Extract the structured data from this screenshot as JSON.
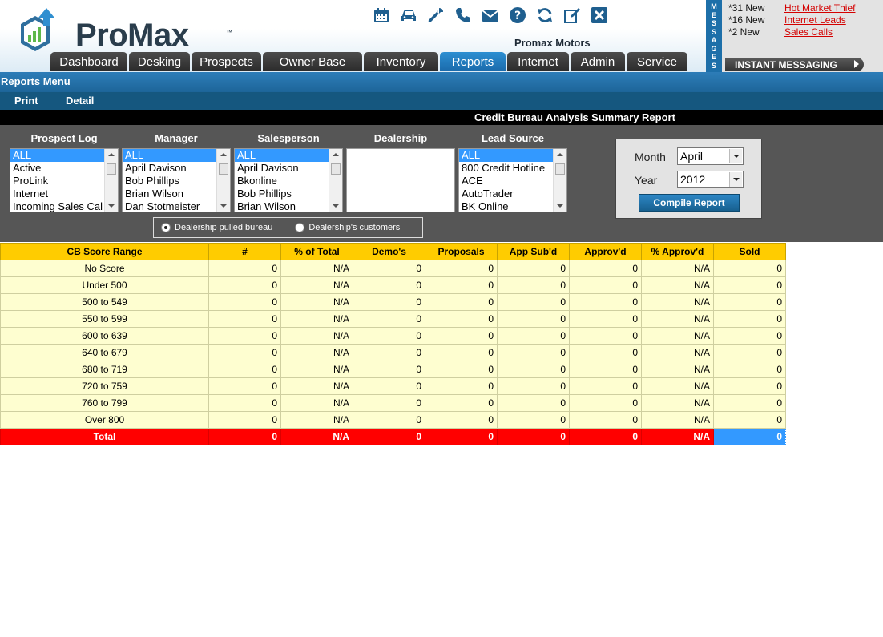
{
  "header": {
    "logo_text": "ProMax",
    "logo_tm": "™",
    "dealer_name": "Promax Motors",
    "toolbar": [
      "calendar-icon",
      "car-icon",
      "wrench-icon",
      "phone-icon",
      "envelope-icon",
      "help-icon",
      "refresh-icon",
      "edit-icon",
      "close-icon"
    ]
  },
  "nav": {
    "tabs": [
      {
        "label": "Dashboard"
      },
      {
        "label": "Desking"
      },
      {
        "label": "Prospects"
      },
      {
        "label": "Owner Base"
      },
      {
        "label": "Inventory"
      },
      {
        "label": "Reports",
        "active": true
      },
      {
        "label": "Internet"
      },
      {
        "label": "Admin"
      },
      {
        "label": "Service"
      }
    ]
  },
  "messages": {
    "strip_label": [
      "M",
      "E",
      "S",
      "S",
      "A",
      "G",
      "E",
      "S"
    ],
    "items": [
      {
        "count": "*31 New",
        "link": "Hot Market Thief"
      },
      {
        "count": "*16 New",
        "link": "Internet Leads"
      },
      {
        "count": "*2 New",
        "link": "Sales Calls"
      }
    ],
    "instant_messaging": "INSTANT MESSAGING"
  },
  "reports_menu": {
    "title": "Reports Menu",
    "print": "Print",
    "detail": "Detail"
  },
  "report_title": "Credit Bureau Analysis Summary Report",
  "filters": {
    "prospect_log": {
      "label": "Prospect Log",
      "items": [
        "ALL",
        "Active",
        "ProLink",
        "Internet",
        "Incoming Sales Cal"
      ]
    },
    "manager": {
      "label": "Manager",
      "items": [
        "ALL",
        "April Davison",
        "Bob Phillips",
        "Brian Wilson",
        "Dan Stotmeister"
      ]
    },
    "salesperson": {
      "label": "Salesperson",
      "items": [
        "ALL",
        "April Davison",
        "Bkonline",
        "Bob Phillips",
        "Brian Wilson"
      ]
    },
    "dealership": {
      "label": "Dealership",
      "items": []
    },
    "lead_source": {
      "label": "Lead Source",
      "items": [
        "ALL",
        "800 Credit Hotline",
        "ACE",
        "AutoTrader",
        "BK Online"
      ]
    },
    "radio": {
      "option1": "Dealership pulled bureau",
      "option2": "Dealership's customers",
      "selected": "option1"
    },
    "date": {
      "month_label": "Month",
      "month_value": "April",
      "year_label": "Year",
      "year_value": "2012",
      "compile_label": "Compile Report"
    }
  },
  "table": {
    "headers": [
      "CB Score Range",
      "#",
      "% of Total",
      "Demo's",
      "Proposals",
      "App Sub'd",
      "Approv'd",
      "% Approv'd",
      "Sold"
    ],
    "rows": [
      [
        "No Score",
        "0",
        "N/A",
        "0",
        "0",
        "0",
        "0",
        "N/A",
        "0"
      ],
      [
        "Under 500",
        "0",
        "N/A",
        "0",
        "0",
        "0",
        "0",
        "N/A",
        "0"
      ],
      [
        "500 to 549",
        "0",
        "N/A",
        "0",
        "0",
        "0",
        "0",
        "N/A",
        "0"
      ],
      [
        "550 to 599",
        "0",
        "N/A",
        "0",
        "0",
        "0",
        "0",
        "N/A",
        "0"
      ],
      [
        "600 to 639",
        "0",
        "N/A",
        "0",
        "0",
        "0",
        "0",
        "N/A",
        "0"
      ],
      [
        "640 to 679",
        "0",
        "N/A",
        "0",
        "0",
        "0",
        "0",
        "N/A",
        "0"
      ],
      [
        "680 to 719",
        "0",
        "N/A",
        "0",
        "0",
        "0",
        "0",
        "N/A",
        "0"
      ],
      [
        "720 to 759",
        "0",
        "N/A",
        "0",
        "0",
        "0",
        "0",
        "N/A",
        "0"
      ],
      [
        "760 to 799",
        "0",
        "N/A",
        "0",
        "0",
        "0",
        "0",
        "N/A",
        "0"
      ],
      [
        "Over 800",
        "0",
        "N/A",
        "0",
        "0",
        "0",
        "0",
        "N/A",
        "0"
      ]
    ],
    "total": [
      "Total",
      "0",
      "N/A",
      "0",
      "0",
      "0",
      "0",
      "N/A",
      "0"
    ]
  },
  "colors": {
    "header_yellow": "#ffcc00",
    "row_yellow": "#fefed0",
    "total_red": "#ff0000",
    "accent_blue": "#1d6fa9",
    "link_red": "#d40000"
  }
}
